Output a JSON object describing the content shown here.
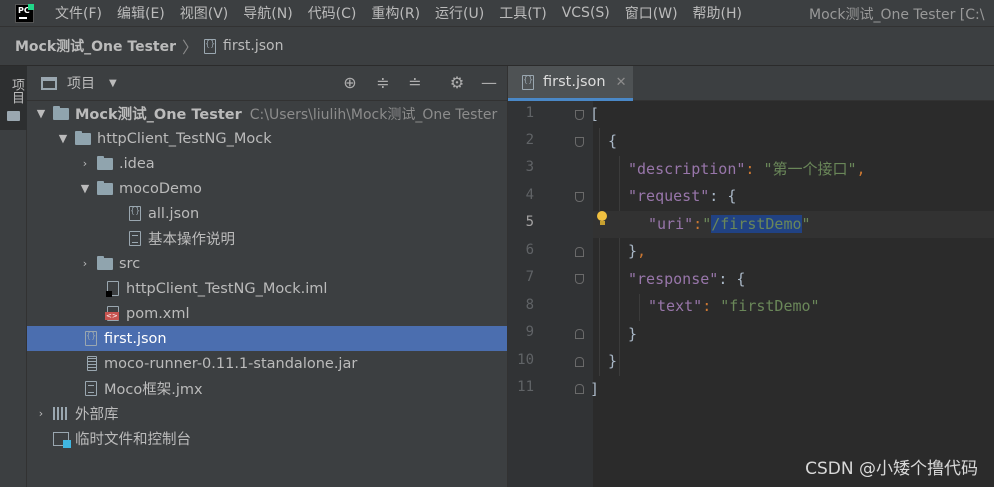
{
  "menubar": {
    "items": [
      "文件(F)",
      "编辑(E)",
      "视图(V)",
      "导航(N)",
      "代码(C)",
      "重构(R)",
      "运行(U)",
      "工具(T)",
      "VCS(S)",
      "窗口(W)",
      "帮助(H)"
    ],
    "window_title": "Mock测试_One Tester [C:\\"
  },
  "breadcrumb": {
    "project": "Mock测试_One Tester",
    "separator": "〉",
    "file": "first.json"
  },
  "toolstrip": {
    "tab_label": "项目"
  },
  "project_panel": {
    "title": "项目",
    "dropdown": "▼",
    "tree": [
      {
        "label": "Mock测试_One Tester",
        "path": "C:\\Users\\liulih\\Mock测试_One Tester",
        "icon": "folder-icon",
        "arrow": "▼"
      },
      {
        "label": "httpClient_TestNG_Mock",
        "icon": "folder-icon",
        "arrow": "▼"
      },
      {
        "label": ".idea",
        "icon": "folder-icon",
        "arrow": "›"
      },
      {
        "label": "mocoDemo",
        "icon": "folder-icon",
        "arrow": "▼"
      },
      {
        "label": "all.json",
        "icon": "json-file-icon"
      },
      {
        "label": "基本操作说明",
        "icon": "text-file-icon"
      },
      {
        "label": "src",
        "icon": "folder-icon",
        "arrow": "›"
      },
      {
        "label": "httpClient_TestNG_Mock.iml",
        "icon": "iml-file-icon"
      },
      {
        "label": "pom.xml",
        "icon": "xml-file-icon"
      },
      {
        "label": "first.json",
        "icon": "json-file-icon",
        "selected": true
      },
      {
        "label": "moco-runner-0.11.1-standalone.jar",
        "icon": "jar-file-icon"
      },
      {
        "label": "Moco框架.jmx",
        "icon": "text-file-icon"
      },
      {
        "label": "外部库",
        "icon": "library-icon",
        "arrow": "›"
      },
      {
        "label": "临时文件和控制台",
        "icon": "scratch-icon"
      }
    ]
  },
  "editor": {
    "tab_label": "first.json",
    "tab_close": "✕",
    "line_numbers": [
      "1",
      "2",
      "3",
      "4",
      "5",
      "6",
      "7",
      "8",
      "9",
      "10",
      "11"
    ],
    "current_line": 5,
    "code": {
      "l1": "[",
      "l2": "{",
      "l3_key": "\"description\"",
      "l3_colon": ": ",
      "l3_val": "\"第一个接口\"",
      "l3_comma": ",",
      "l4_key": "\"request\"",
      "l4_colon": ": {",
      "l5_key": "\"uri\"",
      "l5_colon": ":",
      "l5_q1": "\"",
      "l5_val": "/firstDemo",
      "l5_q2": "\"",
      "l6": "}",
      "l6_comma": ",",
      "l7_key": "\"response\"",
      "l7_colon": ": {",
      "l8_key": "\"text\"",
      "l8_colon": ": ",
      "l8_val": "\"firstDemo\"",
      "l9": "}",
      "l10": "}",
      "l11": "]"
    }
  },
  "watermark": "CSDN @小矮个撸代码",
  "colors": {
    "accent": "#4b6eaf",
    "keyword_purple": "#9876aa",
    "string_green": "#6a8759",
    "punct_orange": "#cc7832",
    "selection": "#214283"
  }
}
